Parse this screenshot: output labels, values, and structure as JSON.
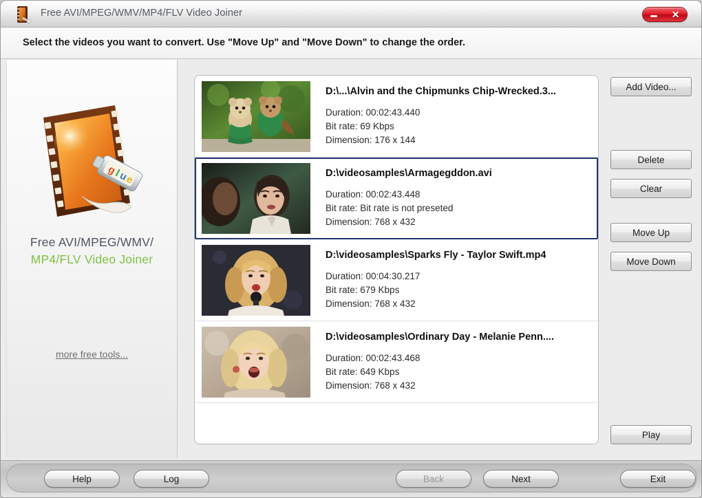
{
  "window": {
    "title": "Free AVI/MPEG/WMV/MP4/FLV Video Joiner",
    "app_icon": "film-reel-icon",
    "minimize_icon": "minimize-icon",
    "close_icon": "close-icon"
  },
  "instruction": {
    "text": "Select the videos you want to convert. Use \"Move Up\" and \"Move Down\" to change the order."
  },
  "sidebar": {
    "logo_icon": "film-strip-glue-tube-icon",
    "product_line1": "Free AVI/MPEG/WMV/",
    "product_line2": "MP4/FLV Video Joiner",
    "more_tools_link": "more free tools...",
    "colors": {
      "line1": "#4b5560",
      "line2": "#7dc143"
    }
  },
  "video_list": {
    "selected_index": 1,
    "selection_border_color": "#20346e",
    "items": [
      {
        "path": "D:\\...\\Alvin and the Chipmunks Chip-Wrecked.3...",
        "duration_label": "Duration: 00:02:43.440",
        "bitrate_label": "Bit rate: 69 Kbps",
        "dimension_label": "Dimension: 176 x 144",
        "thumbnail": "chipmunks-thumbnail",
        "selected": false
      },
      {
        "path": "D:\\videosamples\\Armagegddon.avi",
        "duration_label": "Duration: 00:02:43.448",
        "bitrate_label": "Bit rate: Bit rate is not preseted",
        "dimension_label": "Dimension: 768 x 432",
        "thumbnail": "armageddon-thumbnail",
        "selected": true
      },
      {
        "path": "D:\\videosamples\\Sparks Fly - Taylor Swift.mp4",
        "duration_label": "Duration: 00:04:30.217",
        "bitrate_label": "Bit rate: 679 Kbps",
        "dimension_label": "Dimension: 768 x 432",
        "thumbnail": "sparks-fly-thumbnail",
        "selected": false
      },
      {
        "path": "D:\\videosamples\\Ordinary Day - Melanie Penn....",
        "duration_label": "Duration: 00:02:43.468",
        "bitrate_label": "Bit rate: 649 Kbps",
        "dimension_label": "Dimension: 768 x 432",
        "thumbnail": "ordinary-day-thumbnail",
        "selected": false
      }
    ]
  },
  "side_buttons": {
    "add_video": "Add Video...",
    "delete": "Delete",
    "clear": "Clear",
    "move_up": "Move Up",
    "move_down": "Move Down",
    "play": "Play"
  },
  "footer": {
    "help": "Help",
    "log": "Log",
    "back": "Back",
    "back_disabled": true,
    "next": "Next",
    "exit": "Exit"
  }
}
